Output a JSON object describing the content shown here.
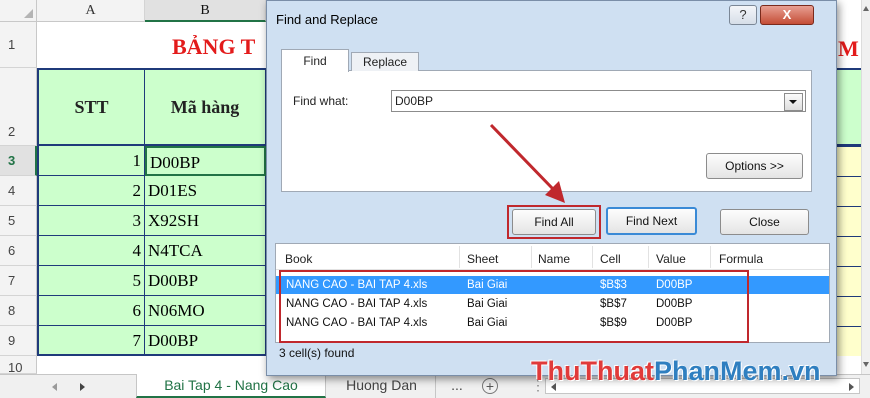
{
  "sheet": {
    "columns": [
      "A",
      "B"
    ],
    "rows": [
      "1",
      "2",
      "3",
      "4",
      "5",
      "6",
      "7",
      "8",
      "9",
      "10"
    ],
    "title_text": "BẢNG T",
    "title_right": "M",
    "headers": {
      "stt": "STT",
      "ma_hang": "Mã hàng"
    },
    "data": [
      {
        "stt": "1",
        "code": "D00BP"
      },
      {
        "stt": "2",
        "code": "D01ES"
      },
      {
        "stt": "3",
        "code": "X92SH"
      },
      {
        "stt": "4",
        "code": "N4TCA"
      },
      {
        "stt": "5",
        "code": "D00BP"
      },
      {
        "stt": "6",
        "code": "N06MO"
      },
      {
        "stt": "7",
        "code": "D00BP"
      }
    ],
    "tabs": {
      "active": "Bai Tap 4 - Nang Cao",
      "other": "Huong Dan",
      "more": "..."
    }
  },
  "dialog": {
    "title": "Find and Replace",
    "help_glyph": "?",
    "close_glyph": "X",
    "tabs": {
      "find": "Find",
      "replace": "Replace"
    },
    "find_what_label": "Find what:",
    "find_what_value": "D00BP",
    "options_button": "Options >>",
    "find_all_button": "Find All",
    "find_next_button": "Find Next",
    "close_button": "Close",
    "results": {
      "columns": [
        "Book",
        "Sheet",
        "Name",
        "Cell",
        "Value",
        "Formula"
      ],
      "rows": [
        {
          "book": "NANG CAO - BAI TAP 4.xls",
          "sheet": "Bai Giai",
          "name": "",
          "cell": "$B$3",
          "value": "D00BP",
          "formula": ""
        },
        {
          "book": "NANG CAO - BAI TAP 4.xls",
          "sheet": "Bai Giai",
          "name": "",
          "cell": "$B$7",
          "value": "D00BP",
          "formula": ""
        },
        {
          "book": "NANG CAO - BAI TAP 4.xls",
          "sheet": "Bai Giai",
          "name": "",
          "cell": "$B$9",
          "value": "D00BP",
          "formula": ""
        }
      ],
      "status": "3 cell(s) found"
    }
  },
  "watermark": {
    "part1": "ThuThuat",
    "part2": "PhanMem",
    "part3": ".vn"
  },
  "colors": {
    "selection": "#3399ff",
    "annotation": "#c0282d",
    "cell_fill": "#ccffcc",
    "title_red": "#e31b1b"
  }
}
